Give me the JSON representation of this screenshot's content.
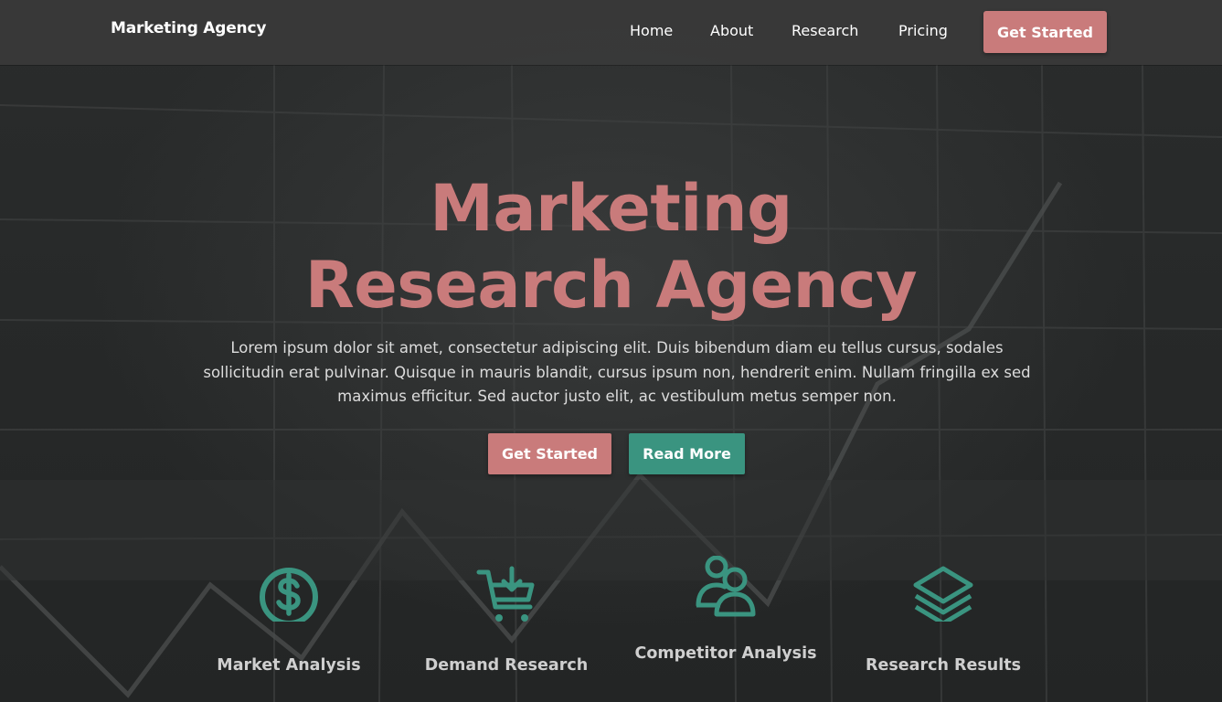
{
  "brand": {
    "name": "Marketing Agency"
  },
  "nav": {
    "links": [
      "Home",
      "About",
      "Research",
      "Pricing"
    ],
    "cta_label": "Get Started"
  },
  "hero": {
    "title_line1": "Marketing",
    "title_line2": "Research Agency",
    "description": "Lorem ipsum dolor sit amet, consectetur adipiscing elit. Duis bibendum diam eu tellus cursus, sodales sollicitudin erat pulvinar. Quisque in mauris blandit, cursus ipsum non, hendrerit enim. Nullam fringilla ex sed maximus efficitur. Sed auctor justo elit, ac vestibulum metus semper non.",
    "primary_button": "Get Started",
    "secondary_button": "Read More"
  },
  "features": [
    {
      "label": "Market Analysis",
      "icon": "dollar-circle-icon"
    },
    {
      "label": "Demand Research",
      "icon": "cart-download-icon"
    },
    {
      "label": "Competitor Analysis",
      "icon": "users-icon"
    },
    {
      "label": "Research Results",
      "icon": "layers-icon"
    }
  ],
  "colors": {
    "accent": "#c97b7b",
    "secondary": "#3a9480",
    "icon": "#3a9480",
    "navbar": "#3a3a3a",
    "background": "#242626"
  }
}
